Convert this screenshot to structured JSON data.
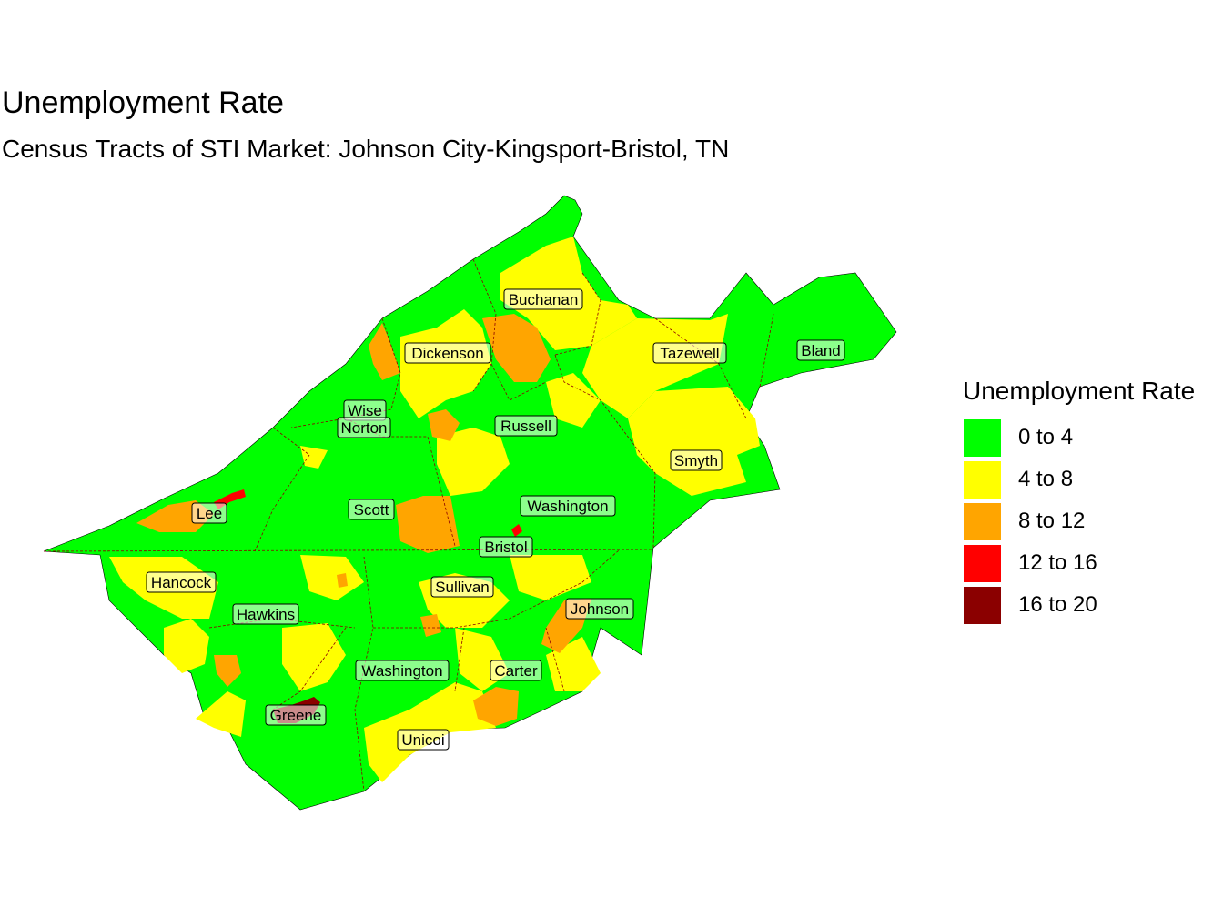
{
  "title": "Unemployment Rate",
  "subtitle": "Census Tracts of STI Market: Johnson City-Kingsport-Bristol, TN",
  "legend": {
    "title": "Unemployment Rate",
    "items": [
      {
        "label": "0 to 4",
        "color": "#00ff00"
      },
      {
        "label": "4 to 8",
        "color": "#ffff00"
      },
      {
        "label": "8 to 12",
        "color": "#ffa500"
      },
      {
        "label": "12 to 16",
        "color": "#ff0000"
      },
      {
        "label": "16 to 20",
        "color": "#8b0000"
      }
    ]
  },
  "counties": [
    {
      "name": "Buchanan"
    },
    {
      "name": "Dickenson"
    },
    {
      "name": "Tazewell"
    },
    {
      "name": "Bland"
    },
    {
      "name": "Wise"
    },
    {
      "name": "Norton"
    },
    {
      "name": "Russell"
    },
    {
      "name": "Smyth"
    },
    {
      "name": "Lee"
    },
    {
      "name": "Scott"
    },
    {
      "name": "Washington"
    },
    {
      "name": "Bristol"
    },
    {
      "name": "Hancock"
    },
    {
      "name": "Sullivan"
    },
    {
      "name": "Johnson"
    },
    {
      "name": "Hawkins"
    },
    {
      "name": "Washington"
    },
    {
      "name": "Carter"
    },
    {
      "name": "Greene"
    },
    {
      "name": "Unicoi"
    }
  ]
}
